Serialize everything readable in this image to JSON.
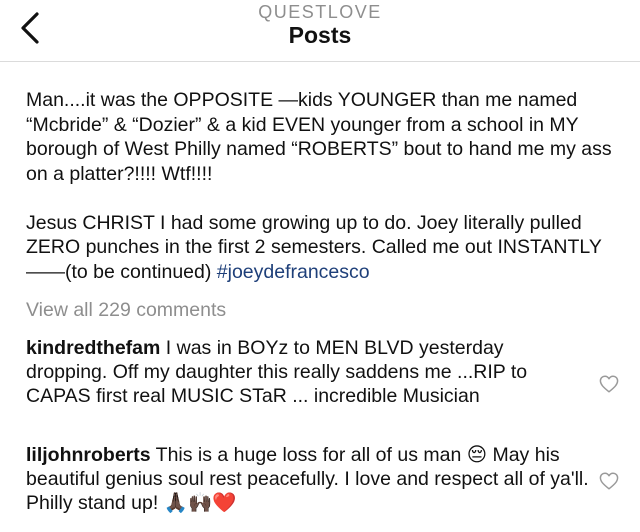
{
  "header": {
    "account": "QUESTLOVE",
    "title": "Posts"
  },
  "caption": {
    "paragraph1": "Man....it was the OPPOSITE —kids YOUNGER than me named “Mcbride” & “Dozier” & a kid EVEN younger from a school in MY borough of West Philly named “ROBERTS” bout to hand me my ass on a platter?!!!! Wtf!!!!",
    "paragraph2": "Jesus CHRIST I had some growing up to do. Joey literally pulled ZERO punches in the first 2 semesters. Called me out INSTANTLY——(to be continued) ",
    "hashtag": "#joeydefrancesco"
  },
  "view_all": "View all 229 comments",
  "comments": [
    {
      "username": "kindredthefam",
      "text": " I was in BOYz to MEN BLVD yesterday dropping. Off my daughter this really saddens me ...RIP to CAPAS first real MUSIC STaR ... incredible Musician"
    },
    {
      "username": "liljohnroberts",
      "text": " This is a huge loss for all of us man 😔 May his beautiful genius soul rest peacefully. I love and respect all of ya'll. Philly stand up! 🙏🏿🙌🏿❤️"
    }
  ],
  "icons": {
    "back": "chevron-left-icon",
    "like": "heart-outline-icon"
  }
}
